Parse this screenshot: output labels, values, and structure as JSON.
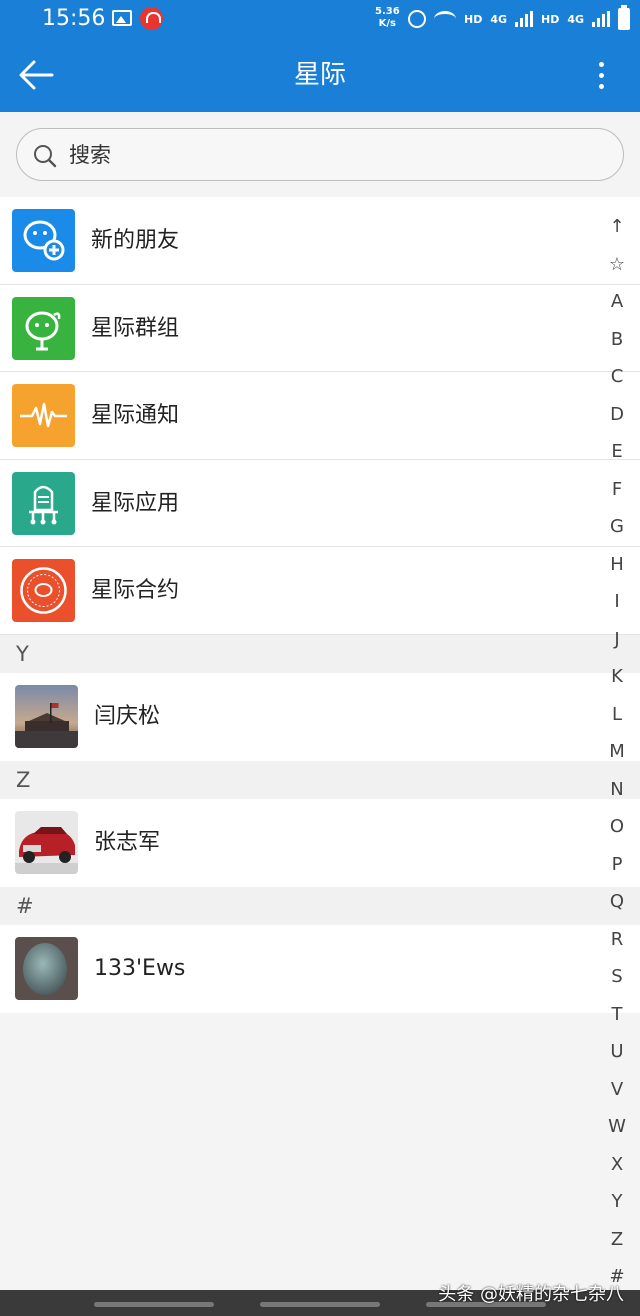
{
  "status_bar": {
    "time": "15:56",
    "net_speed_value": "5.36",
    "net_speed_unit": "K/s",
    "hd1": "HD",
    "net1": "4G",
    "hd2": "HD",
    "net2": "4G"
  },
  "app_bar": {
    "title": "星际"
  },
  "search": {
    "placeholder": "搜索"
  },
  "functions": [
    {
      "label": "新的朋友",
      "color": "#1a8be8",
      "icon": "add-friend-icon"
    },
    {
      "label": "星际群组",
      "color": "#39b33f",
      "icon": "group-face-icon"
    },
    {
      "label": "星际通知",
      "color": "#f5a22e",
      "icon": "pulse-icon"
    },
    {
      "label": "星际应用",
      "color": "#2aa88c",
      "icon": "robot-icon"
    },
    {
      "label": "星际合约",
      "color": "#e9502b",
      "icon": "contract-seal-icon"
    }
  ],
  "sections": [
    {
      "letter": "Y",
      "contacts": [
        {
          "name": "闫庆松",
          "avatar": "monument-photo"
        }
      ]
    },
    {
      "letter": "Z",
      "contacts": [
        {
          "name": "张志军",
          "avatar": "red-car-photo"
        }
      ]
    },
    {
      "letter": "#",
      "contacts": [
        {
          "name": "133'Ews",
          "avatar": "egg-photo"
        }
      ]
    }
  ],
  "index_bar": [
    "↑",
    "☆",
    "A",
    "B",
    "C",
    "D",
    "E",
    "F",
    "G",
    "H",
    "I",
    "J",
    "K",
    "L",
    "M",
    "N",
    "O",
    "P",
    "Q",
    "R",
    "S",
    "T",
    "U",
    "V",
    "W",
    "X",
    "Y",
    "Z",
    "#"
  ],
  "watermark": "头条 @妖精的杂七杂八"
}
